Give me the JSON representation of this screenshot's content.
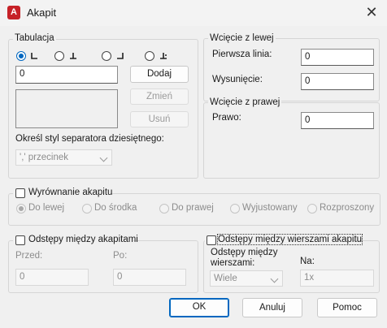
{
  "window": {
    "title": "Akapit",
    "app_icon_letter": "A"
  },
  "tabulacja": {
    "title": "Tabulacja",
    "tab_value": "0",
    "add_label": "Dodaj",
    "modify_label": "Zmień",
    "remove_label": "Usuń",
    "decimal_label": "Określ styl separatora dziesiętnego:",
    "decimal_value": "',' przecinek"
  },
  "left_indent": {
    "title": "Wcięcie z lewej",
    "first_line_label": "Pierwsza linia:",
    "first_line_value": "0",
    "hanging_label": "Wysunięcie:",
    "hanging_value": "0"
  },
  "right_indent": {
    "title": "Wcięcie z prawej",
    "right_label": "Prawo:",
    "right_value": "0"
  },
  "alignment": {
    "title": "Wyrównanie akapitu",
    "options": [
      "Do lewej",
      "Do środka",
      "Do prawej",
      "Wyjustowany",
      "Rozproszony"
    ]
  },
  "para_spacing": {
    "title": "Odstępy między akapitami",
    "before_label": "Przed:",
    "before_value": "0",
    "after_label": "Po:",
    "after_value": "0"
  },
  "line_spacing": {
    "title": "Odstępy między wierszami akapitu",
    "spacing_label_line1": "Odstępy między",
    "spacing_label_line2": "wierszami:",
    "spacing_value": "Wiele",
    "at_label": "Na:",
    "at_value": "1x"
  },
  "footer": {
    "ok": "OK",
    "cancel": "Anuluj",
    "help": "Pomoc"
  }
}
